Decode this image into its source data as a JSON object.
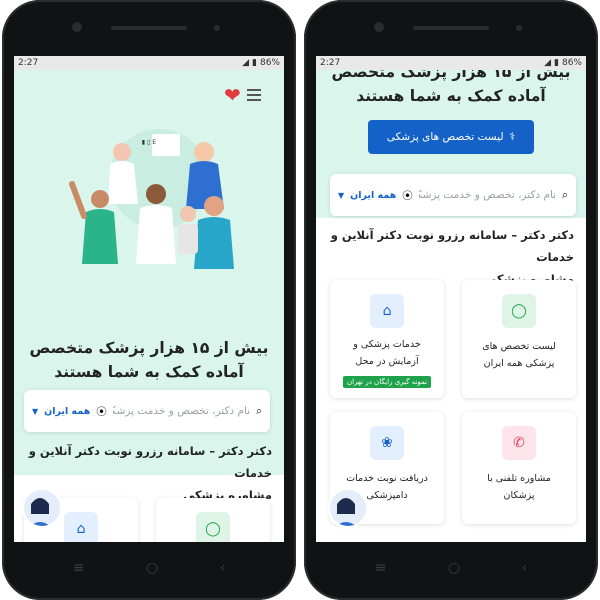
{
  "status": {
    "time": "2:27",
    "battery": "86%"
  },
  "hero": {
    "headline_line1": "بیش از ۱۵ هزار پزشک متخصص",
    "headline_line2": "آماده کمک به شما هستند"
  },
  "cta": {
    "label": "لیست تخصص های پزشکی"
  },
  "search": {
    "placeholder": "نام دکتر، تخصص و خدمت پزشکی",
    "city": "همه ایران"
  },
  "description": {
    "line1": "دکتر دکتر – سامانه رزرو نوبت دکتر آنلاین و خدمات",
    "line2": "مشاوره پزشکی"
  },
  "cards": [
    {
      "label_line1": "لیست تخصص های",
      "label_line2": "پزشکی همه ایران",
      "icon": "person-icon"
    },
    {
      "label_line1": "خدمات پزشکی و",
      "label_line2": "آزمایش در محل",
      "tag": "نمونه گیری رایگان در تهران",
      "icon": "home-medical-icon"
    },
    {
      "label_line1": "مشاوره تلفنی با",
      "label_line2": "پزشکان",
      "icon": "phone-icon"
    },
    {
      "label_line1": "دریافت نوبت خدمات",
      "label_line2": "دامپزشکی",
      "icon": "paw-icon"
    }
  ],
  "colors": {
    "hero_bg": "#d9f5ec",
    "primary": "#1462c8",
    "heart": "#e23b3b",
    "tag": "#1fa34a"
  }
}
